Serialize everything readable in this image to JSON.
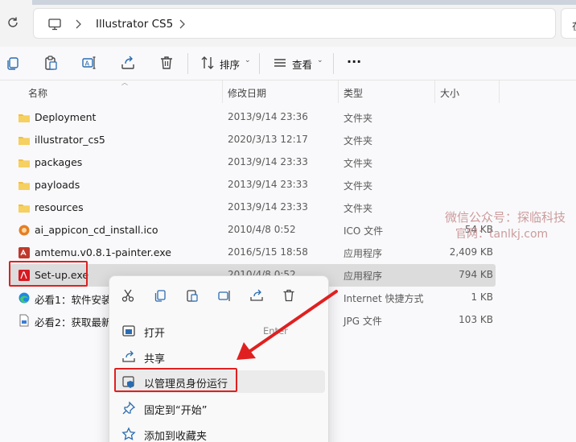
{
  "address": {
    "breadcrumb": "Illustrator CS5",
    "search_partial": "在"
  },
  "toolbar": {
    "sort_label": "排序",
    "view_label": "查看",
    "more_label": "···"
  },
  "columns": {
    "name": "名称",
    "date": "修改日期",
    "type": "类型",
    "size": "大小"
  },
  "files": [
    {
      "name": "Deployment",
      "date": "2013/9/14 23:36",
      "type": "文件夹",
      "size": "",
      "icon": "folder-icon"
    },
    {
      "name": "illustrator_cs5",
      "date": "2020/3/13 12:17",
      "type": "文件夹",
      "size": "",
      "icon": "folder-icon"
    },
    {
      "name": "packages",
      "date": "2013/9/14 23:33",
      "type": "文件夹",
      "size": "",
      "icon": "folder-icon"
    },
    {
      "name": "payloads",
      "date": "2013/9/14 23:33",
      "type": "文件夹",
      "size": "",
      "icon": "folder-icon"
    },
    {
      "name": "resources",
      "date": "2013/9/14 23:33",
      "type": "文件夹",
      "size": "",
      "icon": "folder-icon"
    },
    {
      "name": "ai_appicon_cd_install.ico",
      "date": "2010/4/8 0:52",
      "type": "ICO 文件",
      "size": "54 KB",
      "icon": "ico-file-icon"
    },
    {
      "name": "amtemu.v0.8.1-painter.exe",
      "date": "2016/5/15 18:58",
      "type": "应用程序",
      "size": "2,409 KB",
      "icon": "exe-icon"
    },
    {
      "name": "Set-up.exe",
      "date": "2010/4/8 0:52",
      "type": "应用程序",
      "size": "794 KB",
      "icon": "adobe-icon"
    },
    {
      "name": "必看1：软件安装",
      "date": "",
      "type": "Internet 快捷方式",
      "size": "1 KB",
      "icon": "edge-shortcut-icon"
    },
    {
      "name": "必看2：获取最新",
      "date": "",
      "type": "JPG 文件",
      "size": "103 KB",
      "icon": "jpg-file-icon"
    }
  ],
  "context_menu": {
    "items": [
      {
        "label": "打开",
        "key": "Enter"
      },
      {
        "label": "共享",
        "key": ""
      },
      {
        "label": "以管理员身份运行",
        "key": ""
      },
      {
        "label": "固定到“开始”",
        "key": ""
      },
      {
        "label": "添加到收藏夹",
        "key": ""
      }
    ]
  },
  "watermark": {
    "line1": "微信公众号：探临科技",
    "line2": "官网：tanlkj.com"
  },
  "colors": {
    "highlight_box": "#e02020",
    "folder": "#f0c040",
    "selection": "#dcdcdc"
  }
}
